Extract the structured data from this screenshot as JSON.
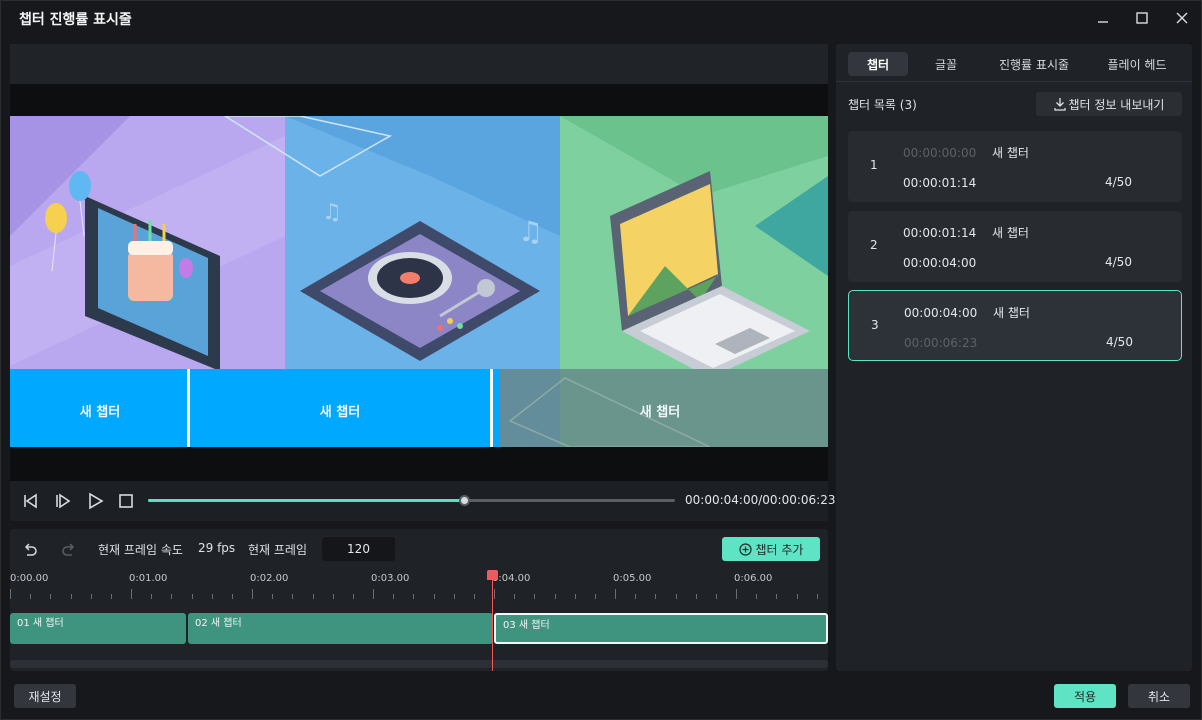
{
  "window": {
    "title": "챕터 진행률 표시줄"
  },
  "preview": {
    "chapter_labels": [
      "새 챕터",
      "새 챕터",
      "새 챕터"
    ]
  },
  "player": {
    "timecode": "00:00:04:00/00:00:06:23",
    "progress": 0.6
  },
  "timeline": {
    "frame_rate_label": "현재 프레임 속도",
    "frame_rate_value": "29 fps",
    "current_frame_label": "현재 프레임",
    "current_frame_value": "120",
    "add_chapter_label": "챕터 추가",
    "ruler": [
      "0:00.00",
      "0:01.00",
      "0:02.00",
      "0:03.00",
      "0:04.00",
      "0:05.00",
      "0:06.00"
    ],
    "clips": [
      {
        "label": "01 새 챕터"
      },
      {
        "label": "02 새 챕터"
      },
      {
        "label": "03 새 챕터"
      }
    ]
  },
  "tabs": [
    {
      "label": "챕터"
    },
    {
      "label": "글꼴"
    },
    {
      "label": "진행률 표시줄"
    },
    {
      "label": "플레이 헤드"
    }
  ],
  "chapter_list": {
    "title": "챕터 목록 (3)",
    "export_label": "챕터 정보 내보내기",
    "items": [
      {
        "num": "1",
        "start": "00:00:00:00",
        "end": "00:00:01:14",
        "name": "새 챕터",
        "count": "4/50"
      },
      {
        "num": "2",
        "start": "00:00:01:14",
        "end": "00:00:04:00",
        "name": "새 챕터",
        "count": "4/50"
      },
      {
        "num": "3",
        "start": "00:00:04:00",
        "end": "00:00:06:23",
        "name": "새 챕터",
        "count": "4/50"
      }
    ]
  },
  "footer": {
    "reset_label": "재설정",
    "apply_label": "적용",
    "cancel_label": "취소"
  },
  "colors": {
    "accent": "#5ee3c4",
    "clip": "#3f9480",
    "playhead": "#f05a5a",
    "chapter_bar": "#00a8ff"
  }
}
